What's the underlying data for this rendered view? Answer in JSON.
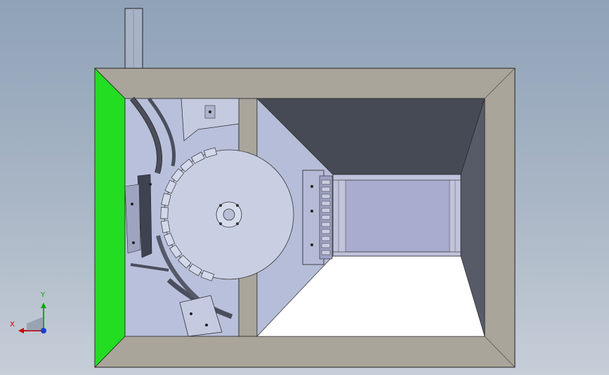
{
  "colors": {
    "background_top": "#8fa2b8",
    "background_bottom": "#c6ced8",
    "frame_face": "#a9a59b",
    "frame_outline": "#222222",
    "left_panel": "#22dd22",
    "interior_light": "#b6bdd8",
    "interior_dark": "#464a55",
    "floor": "#ffffff",
    "axis_x": "#cc0000",
    "axis_y": "#00aa00",
    "axis_origin": "#1a3fcc"
  },
  "triad": {
    "x_label": "X",
    "y_label": "Y"
  }
}
